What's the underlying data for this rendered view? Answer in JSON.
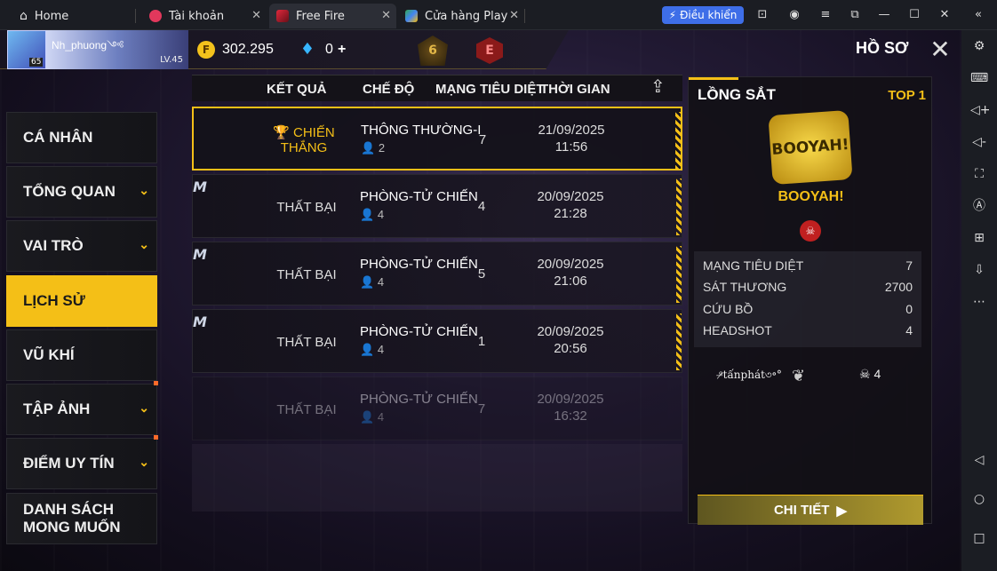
{
  "emulator": {
    "tabs": [
      {
        "label": "Home"
      },
      {
        "label": "Tài khoản"
      },
      {
        "label": "Free Fire"
      },
      {
        "label": "Cửa hàng Play"
      }
    ],
    "control_label": "Điều khiển",
    "accent_color": "#3e6ee8"
  },
  "player": {
    "name": "Nh_phuong༺",
    "avatar_level": "65",
    "level_label": "LV.45"
  },
  "currency": {
    "gold": "302.295",
    "diamonds": "0"
  },
  "ranks": {
    "br_rank": "6",
    "cs_rank": "E"
  },
  "header": {
    "title": "HỒ SƠ"
  },
  "nav": [
    {
      "label": "CÁ NHÂN"
    },
    {
      "label": "TỔNG QUAN"
    },
    {
      "label": "VAI TRÒ"
    },
    {
      "label": "LỊCH SỬ"
    },
    {
      "label": "VŨ KHÍ"
    },
    {
      "label": "TẬP ẢNH"
    },
    {
      "label": "ĐIỂM UY TÍN"
    },
    {
      "label": "DANH SÁCH MONG MUỐN"
    }
  ],
  "table": {
    "headers": [
      "KẾT QUẢ",
      "CHẾ ĐỘ",
      "MẠNG TIÊU DIỆT",
      "THỜI GIAN"
    ],
    "rows": [
      {
        "result": "CHIẾN THẮNG",
        "mode": "THÔNG THƯỜNG-I",
        "players": "2",
        "kills": "7",
        "date": "21/09/2025",
        "time": "11:56"
      },
      {
        "result": "THẤT BẠI",
        "mode": "PHÒNG-TỬ CHIẾN",
        "players": "4",
        "kills": "4",
        "date": "20/09/2025",
        "time": "21:28"
      },
      {
        "result": "THẤT BẠI",
        "mode": "PHÒNG-TỬ CHIẾN",
        "players": "4",
        "kills": "5",
        "date": "20/09/2025",
        "time": "21:06"
      },
      {
        "result": "THẤT BẠI",
        "mode": "PHÒNG-TỬ CHIẾN",
        "players": "4",
        "kills": "1",
        "date": "20/09/2025",
        "time": "20:56"
      },
      {
        "result": "THẤT BẠI",
        "mode": "PHÒNG-TỬ CHIẾN",
        "players": "4",
        "kills": "7",
        "date": "20/09/2025",
        "time": "16:32"
      }
    ]
  },
  "detail": {
    "map": "LỒNG SẮT",
    "rank": "TOP 1",
    "booyah_art": "BOOYAH!",
    "booyah_label": "BOOYAH!",
    "stats": [
      {
        "label": "MẠNG TIÊU DIỆT",
        "value": "7"
      },
      {
        "label": "SÁT THƯƠNG",
        "value": "2700"
      },
      {
        "label": "CỨU BỒ",
        "value": "0"
      },
      {
        "label": "HEADSHOT",
        "value": "4"
      }
    ],
    "teammate": "ᵒ̶̷tấnphát৩॰°",
    "teammate_kills": "4",
    "button_label": "CHI TIẾT"
  }
}
